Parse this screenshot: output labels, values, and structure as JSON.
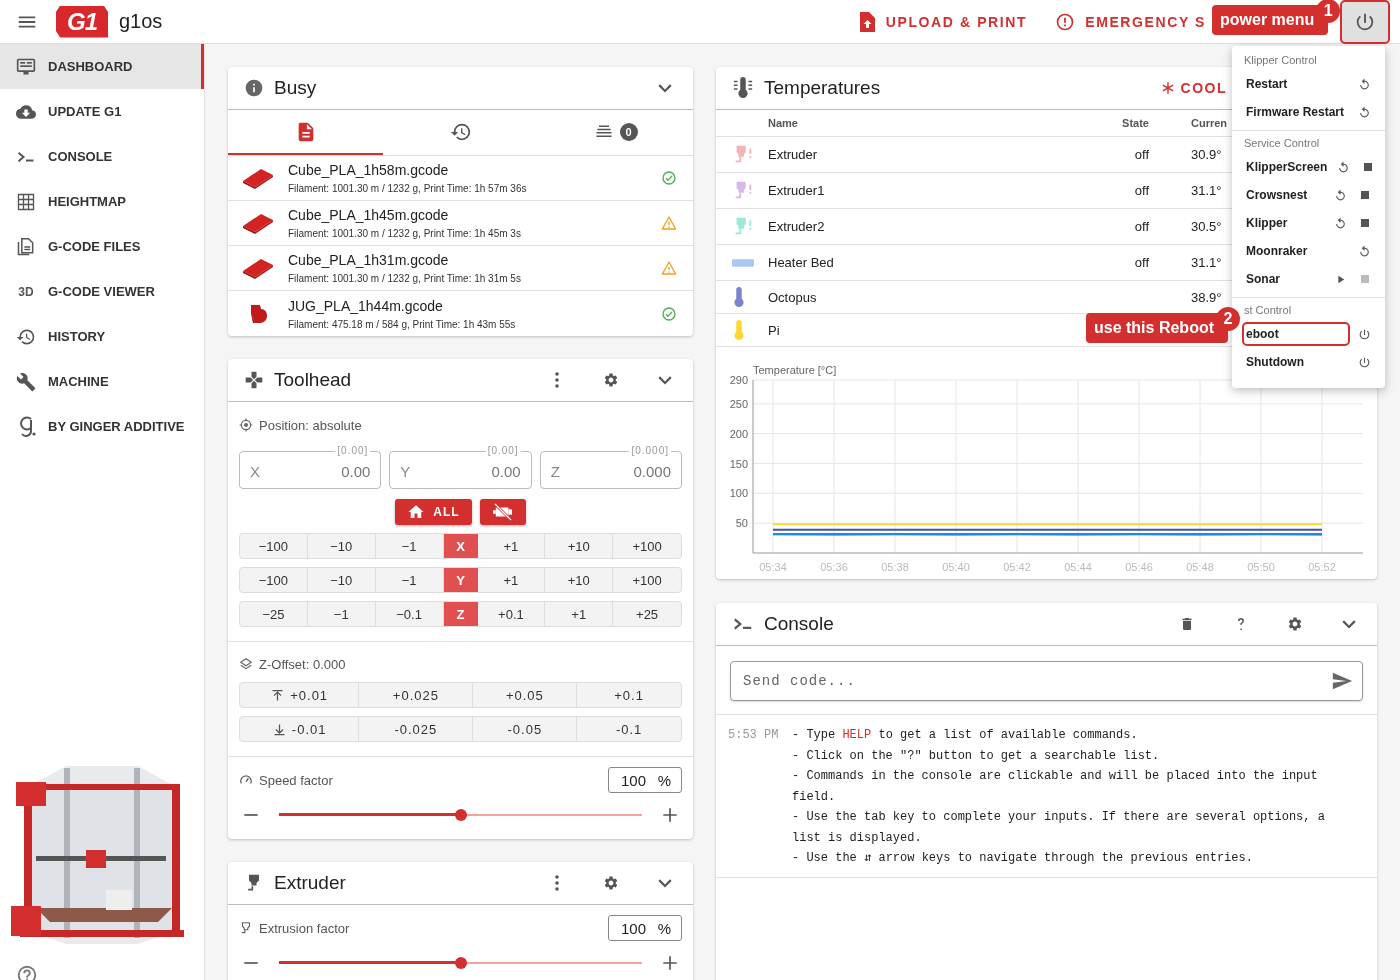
{
  "header": {
    "logo": "G1",
    "app_name": "g1os",
    "actions": [
      {
        "label": "UPLOAD & PRINT",
        "kind": "upload"
      },
      {
        "label": "EMERGENCY S",
        "kind": "emergency"
      }
    ],
    "power_button": {
      "highlighted": true
    }
  },
  "sidebar": {
    "items": [
      {
        "label": "DASHBOARD",
        "selected": true
      },
      {
        "label": "UPDATE G1",
        "selected": false
      },
      {
        "label": "CONSOLE",
        "selected": false
      },
      {
        "label": "HEIGHTMAP",
        "selected": false
      },
      {
        "label": "G-CODE FILES",
        "selected": false
      },
      {
        "label": "G-CODE VIEWER",
        "selected": false,
        "glyph": "3D"
      },
      {
        "label": "HISTORY",
        "selected": false
      },
      {
        "label": "MACHINE",
        "selected": false
      },
      {
        "label": "BY GINGER ADDITIVE",
        "selected": false
      }
    ]
  },
  "busy": {
    "title": "Busy",
    "tabs": [
      {
        "selected": true
      },
      {
        "selected": false
      },
      {
        "selected": false,
        "badge": "0"
      }
    ],
    "files": [
      {
        "name": "Cube_PLA_1h58m.gcode",
        "details": "Filament: 1001.30 m / 1232 g, Print Time: 1h 57m 36s",
        "warning": false,
        "kind": "slab"
      },
      {
        "name": "Cube_PLA_1h45m.gcode",
        "details": "Filament: 1001.30 m / 1232 g, Print Time: 1h 45m 3s",
        "warning": true,
        "kind": "slab"
      },
      {
        "name": "Cube_PLA_1h31m.gcode",
        "details": "Filament: 1001.30 m / 1232 g, Print Time: 1h 31m 5s",
        "warning": true,
        "kind": "slab"
      },
      {
        "name": "JUG_PLA_1h44m.gcode",
        "details": "Filament: 475.18 m / 584 g, Print Time: 1h 43m 55s",
        "warning": false,
        "kind": "jug"
      }
    ]
  },
  "toolhead": {
    "title": "Toolhead",
    "position_label": "Position: absolute",
    "fields": [
      {
        "label": "X",
        "hint": "[0.00]",
        "value": "0.00"
      },
      {
        "label": "Y",
        "hint": "[0.00]",
        "value": "0.00"
      },
      {
        "label": "Z",
        "hint": "[0.000]",
        "value": "0.000"
      }
    ],
    "home_label": "ALL",
    "jog_rows": [
      {
        "axis": "X",
        "minus": [
          "−100",
          "−10",
          "−1"
        ],
        "plus": [
          "+1",
          "+10",
          "+100"
        ]
      },
      {
        "axis": "Y",
        "minus": [
          "−100",
          "−10",
          "−1"
        ],
        "plus": [
          "+1",
          "+10",
          "+100"
        ]
      },
      {
        "axis": "Z",
        "minus": [
          "−25",
          "−1",
          "−0.1"
        ],
        "plus": [
          "+0.1",
          "+1",
          "+25"
        ]
      }
    ],
    "zoffset": {
      "label": "Z-Offset: 0.000",
      "up": [
        "+0.01",
        "+0.025",
        "+0.05",
        "+0.1"
      ],
      "down": [
        "-0.01",
        "-0.025",
        "-0.05",
        "-0.1"
      ]
    },
    "speed": {
      "label": "Speed factor",
      "value": "100",
      "unit": "%",
      "level": 0.5
    }
  },
  "extruder": {
    "title": "Extruder",
    "factor": {
      "label": "Extrusion factor",
      "value": "100",
      "unit": "%",
      "level": 0.5
    }
  },
  "temperatures": {
    "title": "Temperatures",
    "cooldown": "COOL",
    "columns": [
      "Name",
      "State",
      "Curren"
    ],
    "rows": [
      {
        "name": "Extruder",
        "state": "off",
        "current": "30.9°",
        "color": "#f6b3b3",
        "kind": "extruder"
      },
      {
        "name": "Extruder1",
        "state": "off",
        "current": "31.1°",
        "color": "#d9b8e8",
        "kind": "extruder"
      },
      {
        "name": "Extruder2",
        "state": "off",
        "current": "30.5°",
        "color": "#9fe8d8",
        "kind": "extruder"
      },
      {
        "name": "Heater Bed",
        "state": "off",
        "current": "31.1°",
        "color": "#a8c8f0",
        "kind": "bed"
      },
      {
        "name": "Octopus",
        "current": "38.9°",
        "color": "#7986cb",
        "kind": "sensor"
      },
      {
        "name": "Pi",
        "color": "#fdd835",
        "kind": "sensor"
      }
    ],
    "chart_data": {
      "type": "line",
      "ylabel": "Temperature [°C]",
      "x": [
        "05:34",
        "05:36",
        "05:38",
        "05:40",
        "05:42",
        "05:44",
        "05:46",
        "05:48",
        "05:50",
        "05:52"
      ],
      "ylim": [
        0,
        290
      ],
      "yticks": [
        50,
        100,
        150,
        200,
        250,
        290
      ],
      "grid": true,
      "series": [
        {
          "color": "#fdd835",
          "values": [
            48,
            48,
            48,
            48,
            48,
            48,
            48,
            48,
            48,
            48
          ]
        },
        {
          "color": "#3f51b5",
          "values": [
            39,
            39,
            39,
            39,
            39,
            39,
            39,
            39,
            39,
            39
          ]
        },
        {
          "color": "#4fc3f7",
          "values": [
            31,
            30,
            31,
            30,
            31,
            30,
            31,
            30,
            31,
            30
          ]
        },
        {
          "color": "#1e88e5",
          "values": [
            32,
            32,
            32,
            32,
            32,
            32,
            32,
            32,
            32,
            32
          ]
        }
      ]
    }
  },
  "console": {
    "title": "Console",
    "placeholder": "Send code...",
    "time": "5:53 PM",
    "lines": [
      {
        "parts": [
          {
            "text": "- Type ",
            "kind": "plain"
          },
          {
            "text": "HELP",
            "kind": "command"
          },
          {
            "text": " to get a list of available commands.",
            "kind": "plain"
          }
        ]
      },
      {
        "parts": [
          {
            "text": "- Click on the \"?\" button to get a searchable list.",
            "kind": "plain"
          }
        ]
      },
      {
        "parts": [
          {
            "text": "- Commands in the console are clickable and will be placed into the input field.",
            "kind": "plain"
          }
        ]
      },
      {
        "parts": [
          {
            "text": "- Use the tab key to complete your inputs. If there are several options, a list is displayed.",
            "kind": "plain"
          }
        ]
      },
      {
        "parts": [
          {
            "text": "- Use the ⇵ arrow keys to navigate through the previous entries.",
            "kind": "plain"
          }
        ]
      }
    ]
  },
  "power_menu": {
    "sections": [
      {
        "header": "Klipper Control",
        "items": [
          {
            "label": "Restart",
            "highlighted": false,
            "actions": [
              {
                "kind": "restart",
                "disabled": false
              }
            ]
          },
          {
            "label": "Firmware Restart",
            "highlighted": false,
            "actions": [
              {
                "kind": "restart",
                "disabled": false
              }
            ]
          }
        ]
      },
      {
        "header": "Service Control",
        "items": [
          {
            "label": "KlipperScreen",
            "highlighted": false,
            "actions": [
              {
                "kind": "restart",
                "disabled": false
              },
              {
                "kind": "stop",
                "disabled": false
              }
            ]
          },
          {
            "label": "Crowsnest",
            "highlighted": false,
            "actions": [
              {
                "kind": "restart",
                "disabled": false
              },
              {
                "kind": "stop",
                "disabled": false
              }
            ]
          },
          {
            "label": "Klipper",
            "highlighted": false,
            "actions": [
              {
                "kind": "restart",
                "disabled": false
              },
              {
                "kind": "stop",
                "disabled": false
              }
            ]
          },
          {
            "label": "Moonraker",
            "highlighted": false,
            "actions": [
              {
                "kind": "restart",
                "disabled": false
              }
            ]
          },
          {
            "label": "Sonar",
            "highlighted": false,
            "actions": [
              {
                "kind": "start",
                "disabled": false
              },
              {
                "kind": "stop",
                "disabled": true
              }
            ]
          }
        ]
      },
      {
        "header": "st Control",
        "items": [
          {
            "label": "eboot",
            "highlighted": true,
            "actions": [
              {
                "kind": "power",
                "disabled": false
              }
            ]
          },
          {
            "label": "Shutdown",
            "highlighted": false,
            "actions": [
              {
                "kind": "power",
                "disabled": false
              }
            ]
          }
        ]
      }
    ]
  },
  "annotations": [
    {
      "text": "power menu",
      "number": "1"
    },
    {
      "text": "use this Reboot",
      "number": "2"
    }
  ]
}
